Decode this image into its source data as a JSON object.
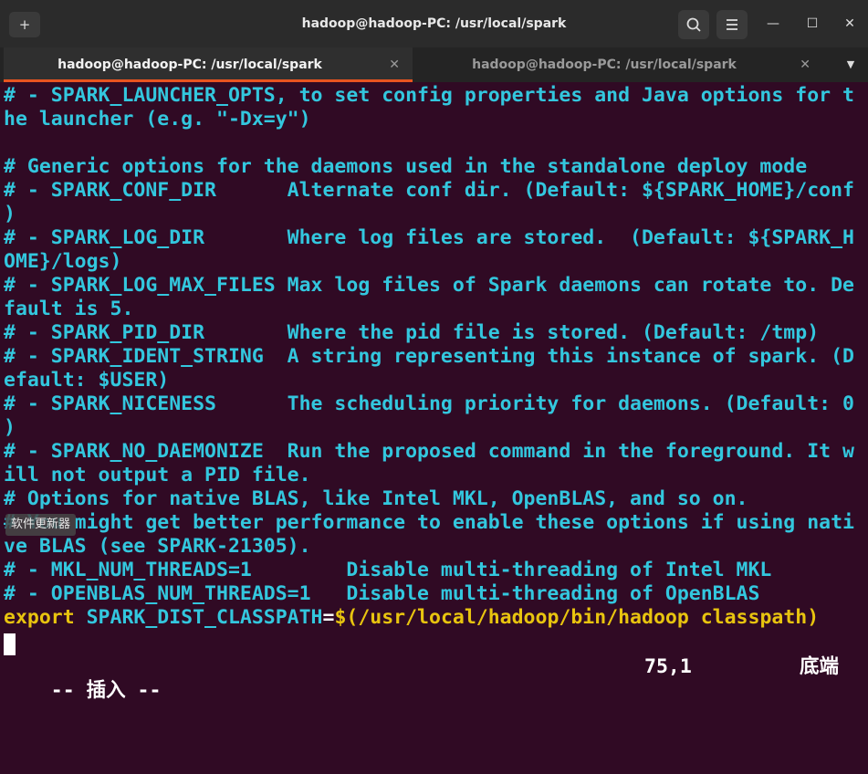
{
  "window": {
    "title": "hadoop@hadoop-PC: /usr/local/spark",
    "new_tab_icon": "+",
    "minimize_icon": "—",
    "maximize_icon": "☐",
    "close_icon": "✕"
  },
  "tabs": [
    {
      "label": "hadoop@hadoop-PC: /usr/local/spark",
      "active": true,
      "close": "✕"
    },
    {
      "label": "hadoop@hadoop-PC: /usr/local/spark",
      "active": false,
      "close": "✕"
    }
  ],
  "tab_menu_icon": "▼",
  "terminal": {
    "lines": [
      {
        "text": "# - SPARK_LAUNCHER_OPTS, to set config properties and Java options for t"
      },
      {
        "text": "he launcher (e.g. \"-Dx=y\")"
      },
      {
        "text": ""
      },
      {
        "text": "# Generic options for the daemons used in the standalone deploy mode"
      },
      {
        "text": "# - SPARK_CONF_DIR      Alternate conf dir. (Default: ${SPARK_HOME}/conf"
      },
      {
        "text": ")"
      },
      {
        "text": "# - SPARK_LOG_DIR       Where log files are stored.  (Default: ${SPARK_H"
      },
      {
        "text": "OME}/logs)"
      },
      {
        "text": "# - SPARK_LOG_MAX_FILES Max log files of Spark daemons can rotate to. De"
      },
      {
        "text": "fault is 5."
      },
      {
        "text": "# - SPARK_PID_DIR       Where the pid file is stored. (Default: /tmp)"
      },
      {
        "text": "# - SPARK_IDENT_STRING  A string representing this instance of spark. (D"
      },
      {
        "text": "efault: $USER)"
      },
      {
        "text": "# - SPARK_NICENESS      The scheduling priority for daemons. (Default: 0"
      },
      {
        "text": ")"
      },
      {
        "text": "# - SPARK_NO_DAEMONIZE  Run the proposed command in the foreground. It w"
      },
      {
        "text": "ill not output a PID file."
      },
      {
        "text": "# Options for native BLAS, like Intel MKL, OpenBLAS, and so on."
      },
      {
        "text": "# You might get better performance to enable these options if using nati"
      },
      {
        "text": "ve BLAS (see SPARK-21305)."
      },
      {
        "text": "# - MKL_NUM_THREADS=1        Disable multi-threading of Intel MKL"
      },
      {
        "text": "# - OPENBLAS_NUM_THREADS=1   Disable multi-threading of OpenBLAS"
      }
    ],
    "export_line": {
      "keyword": "export",
      "var": " SPARK_DIST_CLASSPATH",
      "eq": "=",
      "value": "$(/usr/local/hadoop/bin/hadoop classpath)"
    },
    "status_mode": "-- 插入 --",
    "status_position": "75,1",
    "status_where": "底端"
  },
  "tooltip": "软件更新器",
  "colors": {
    "background": "#300a24",
    "comment": "#33c7de",
    "keyword": "#e8c40f",
    "accent": "#e95420"
  }
}
